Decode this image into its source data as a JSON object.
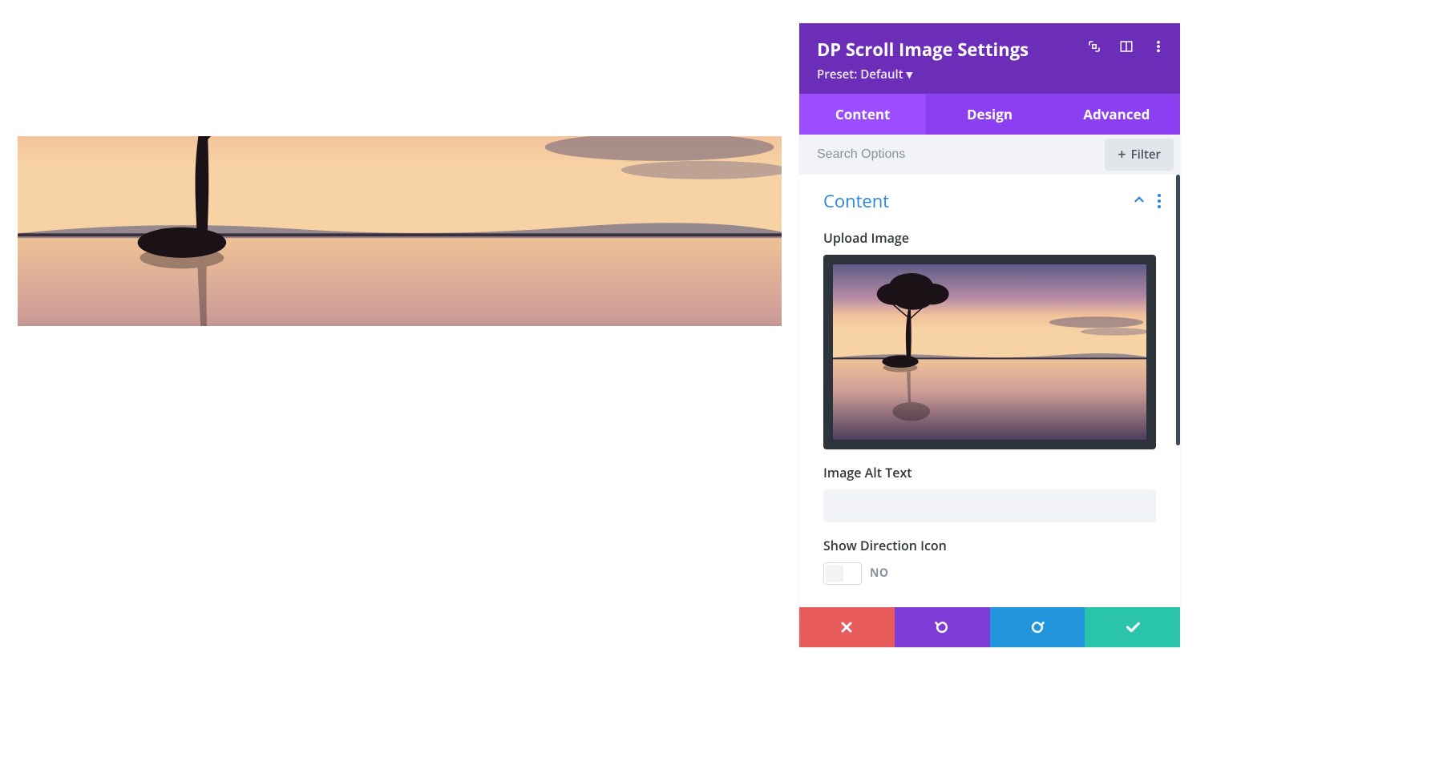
{
  "panel": {
    "title": "DP Scroll Image Settings",
    "preset_label": "Preset: Default",
    "tabs": [
      "Content",
      "Design",
      "Advanced"
    ],
    "active_tab": "Content",
    "search_placeholder": "Search Options",
    "filter_label": "Filter",
    "section_title": "Content",
    "fields": {
      "upload_label": "Upload Image",
      "alt_label": "Image Alt Text",
      "alt_value": "",
      "direction_label": "Show Direction Icon",
      "direction_value": "NO"
    }
  },
  "colors": {
    "header_purple": "#6c2eb9",
    "tab_purple": "#8b3ff0",
    "tab_active": "#9b4dff",
    "link_blue": "#2b87da",
    "cancel": "#e85c5c",
    "undo": "#7e3bd6",
    "redo": "#2296dd",
    "save": "#29c4a9"
  }
}
